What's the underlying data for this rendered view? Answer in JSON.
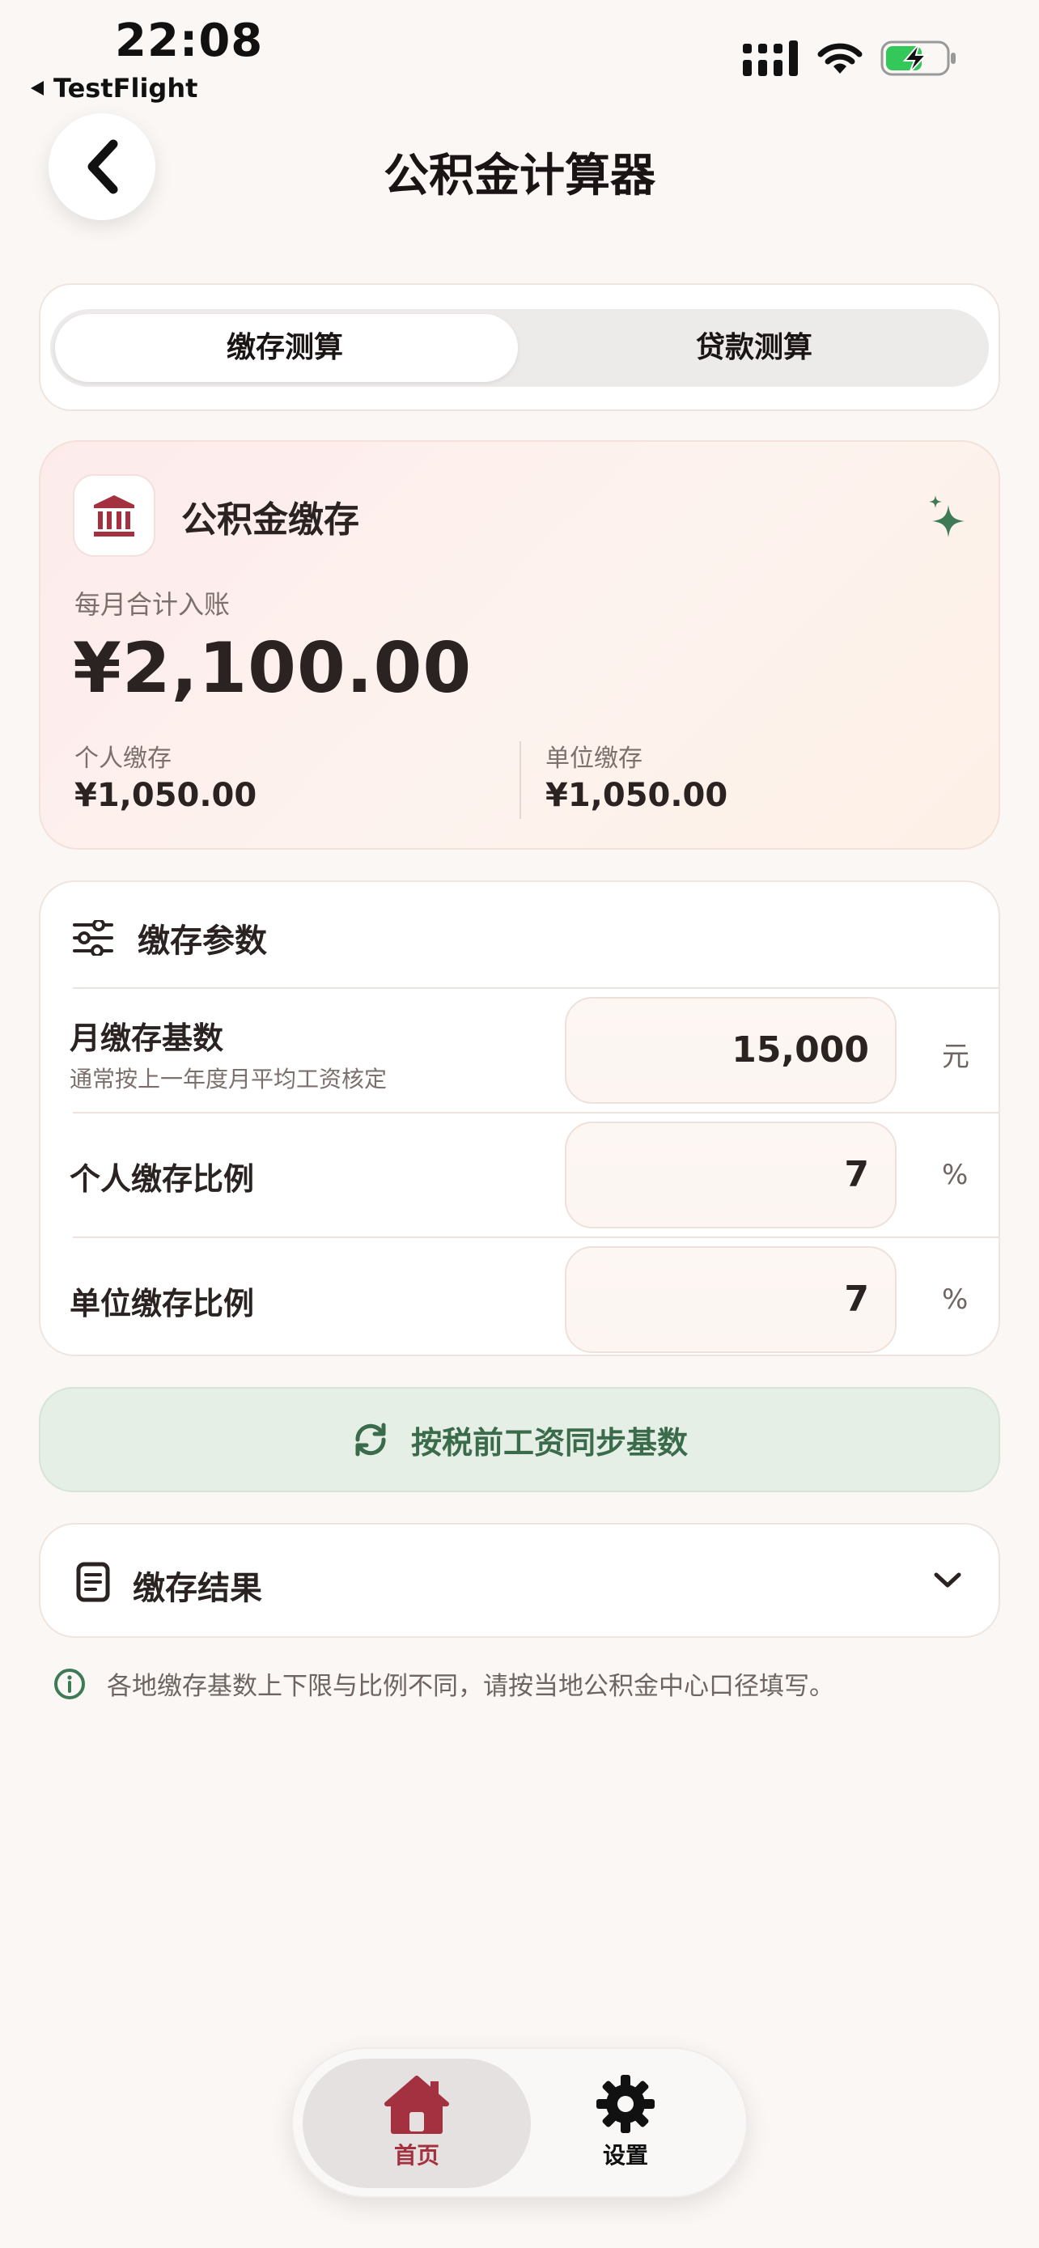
{
  "status_bar": {
    "time": "22:08",
    "back_app": "TestFlight",
    "icons": [
      "signal-icon",
      "wifi-icon",
      "battery-charging-icon"
    ]
  },
  "nav": {
    "title": "公积金计算器",
    "back_icon": "chevron-left-icon"
  },
  "segments": {
    "items": [
      {
        "label": "缴存测算",
        "selected": true
      },
      {
        "label": "贷款测算",
        "selected": false
      }
    ]
  },
  "summary": {
    "title": "公积金缴存",
    "icon": "bank-icon",
    "sparkle_icon": "sparkle-icon",
    "total_label": "每月合计入账",
    "total_value": "¥2,100.00",
    "personal_label": "个人缴存",
    "personal_value": "¥1,050.00",
    "employer_label": "单位缴存",
    "employer_value": "¥1,050.00"
  },
  "params": {
    "title": "缴存参数",
    "icon": "sliders-icon",
    "rows": [
      {
        "label": "月缴存基数",
        "hint": "通常按上一年度月平均工资核定",
        "value": "15,000",
        "unit": "元"
      },
      {
        "label": "个人缴存比例",
        "hint": "",
        "value": "7",
        "unit": "%"
      },
      {
        "label": "单位缴存比例",
        "hint": "",
        "value": "7",
        "unit": "%"
      }
    ]
  },
  "sync_button": {
    "label": "按税前工资同步基数",
    "icon": "sync-icon"
  },
  "results": {
    "title": "缴存结果",
    "icon": "document-icon",
    "chevron": "chevron-down-icon"
  },
  "note": {
    "text": "各地缴存基数上下限与比例不同，请按当地公积金中心口径填写。",
    "icon": "info-icon"
  },
  "tabbar": {
    "items": [
      {
        "label": "首页",
        "icon": "home-icon",
        "active": true
      },
      {
        "label": "设置",
        "icon": "gear-icon",
        "active": false
      }
    ]
  },
  "colors": {
    "accent": "#A3313F",
    "green": "#3A6B4B",
    "background": "#FAF7F4"
  }
}
